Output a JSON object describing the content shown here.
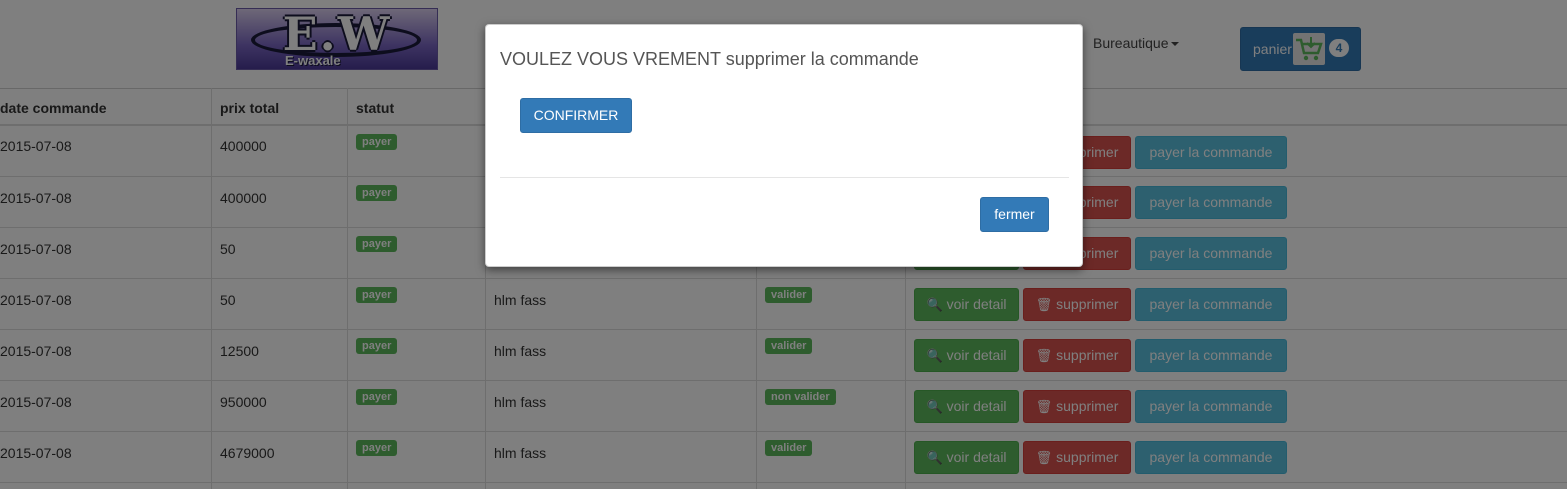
{
  "header": {
    "logo_text": "E.W",
    "logo_sub": "E-waxale",
    "nav_dropdown": "Bureautique",
    "cart_label": "panier",
    "cart_count": "4"
  },
  "table": {
    "columns": [
      "date commande",
      "prix total",
      "statut"
    ],
    "rows": [
      {
        "date": "2015-07-08",
        "prix": "400000",
        "statut": "payer",
        "adresse": "",
        "validation": ""
      },
      {
        "date": "2015-07-08",
        "prix": "400000",
        "statut": "payer",
        "adresse": "",
        "validation": ""
      },
      {
        "date": "2015-07-08",
        "prix": "50",
        "statut": "payer",
        "adresse": "",
        "validation": ""
      },
      {
        "date": "2015-07-08",
        "prix": "50",
        "statut": "payer",
        "adresse": "hlm fass",
        "validation": "valider"
      },
      {
        "date": "2015-07-08",
        "prix": "12500",
        "statut": "payer",
        "adresse": "hlm fass",
        "validation": "valider"
      },
      {
        "date": "2015-07-08",
        "prix": "950000",
        "statut": "payer",
        "adresse": "hlm fass",
        "validation": "non valider"
      },
      {
        "date": "2015-07-08",
        "prix": "4679000",
        "statut": "payer",
        "adresse": "hlm fass",
        "validation": "valider"
      }
    ],
    "actions": {
      "detail": "voir detail",
      "delete": "supprimer",
      "pay": "payer la commande"
    }
  },
  "modal": {
    "title": "VOULEZ VOUS VREMENT supprimer la commande",
    "confirm": "CONFIRMER",
    "close": "fermer"
  },
  "icons": {
    "detail": "zoom-in-icon",
    "delete": "trash-icon",
    "cart": "cart-icon"
  },
  "colors": {
    "primary": "#337ab7",
    "success": "#5cb85c",
    "danger": "#d9534f",
    "info": "#5bc0de"
  }
}
